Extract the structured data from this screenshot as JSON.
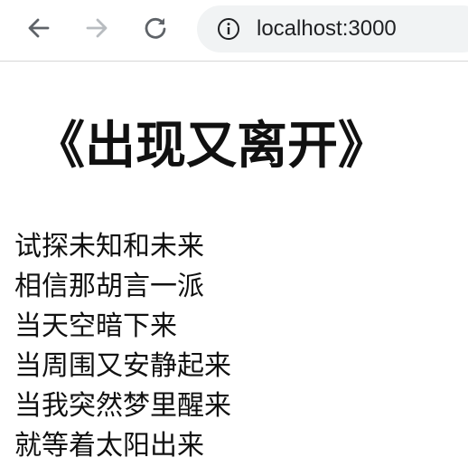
{
  "browser": {
    "url": "localhost:3000",
    "icons": {
      "back": "arrow-left-icon",
      "forward": "arrow-right-icon",
      "reload": "reload-icon",
      "site_info": "info-circle-icon"
    },
    "colors": {
      "toolbar_background": "#ffffff",
      "address_bar_background": "#f1f3f4",
      "icon_active": "#5f6368",
      "icon_disabled": "#b8bcc0"
    }
  },
  "page": {
    "title": "《出现又离开》",
    "lines": [
      "试探未知和未来",
      "相信那胡言一派",
      "当天空暗下来",
      "当周围又安静起来",
      "当我突然梦里醒来",
      "就等着太阳出来"
    ]
  }
}
